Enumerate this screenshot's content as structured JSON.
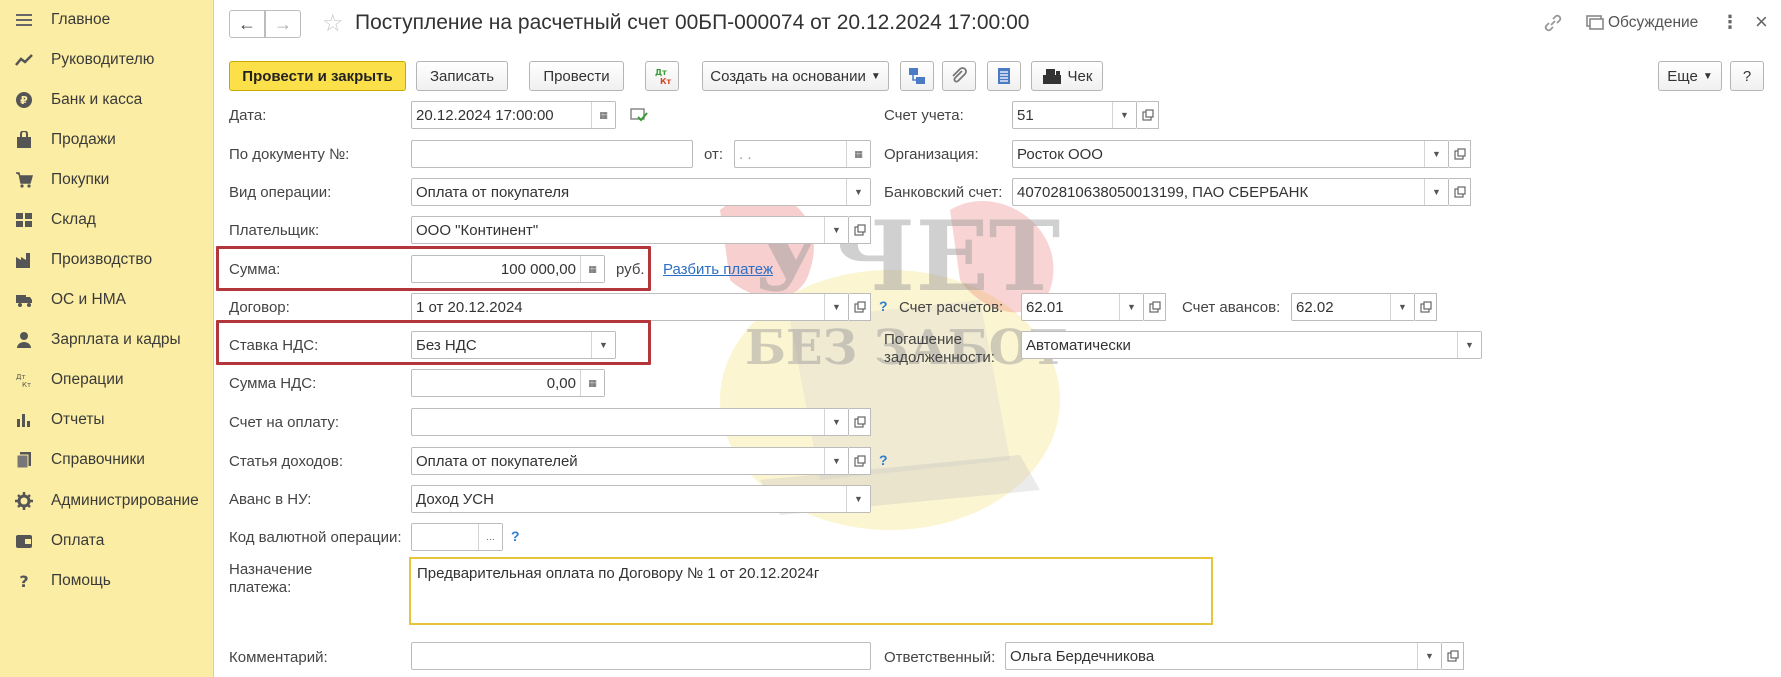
{
  "sidebar": {
    "items": [
      {
        "label": "Главное",
        "icon": "menu-icon"
      },
      {
        "label": "Руководителю",
        "icon": "trend-icon"
      },
      {
        "label": "Банк и касса",
        "icon": "ruble-coin-icon"
      },
      {
        "label": "Продажи",
        "icon": "shopping-bag-icon"
      },
      {
        "label": "Покупки",
        "icon": "cart-icon"
      },
      {
        "label": "Склад",
        "icon": "warehouse-icon"
      },
      {
        "label": "Производство",
        "icon": "factory-icon"
      },
      {
        "label": "ОС и НМА",
        "icon": "truck-icon"
      },
      {
        "label": "Зарплата и кадры",
        "icon": "person-icon"
      },
      {
        "label": "Операции",
        "icon": "dt-kt-icon"
      },
      {
        "label": "Отчеты",
        "icon": "bar-chart-icon"
      },
      {
        "label": "Справочники",
        "icon": "book-icon"
      },
      {
        "label": "Администрирование",
        "icon": "gear-icon"
      },
      {
        "label": "Оплата",
        "icon": "wallet-icon"
      },
      {
        "label": "Помощь",
        "icon": "question-icon"
      }
    ]
  },
  "header": {
    "title": "Поступление на расчетный счет 00БП-000074 от 20.12.2024 17:00:00",
    "discussion": "Обсуждение"
  },
  "toolbar": {
    "post_close": "Провести и закрыть",
    "save": "Записать",
    "post": "Провести",
    "create_based": "Создать на основании",
    "receipt": "Чек",
    "more": "Еще",
    "help": "?",
    "dtkt_top": "Дт",
    "dtkt_bottom": "Кт"
  },
  "form": {
    "date": {
      "label": "Дата:",
      "value": "20.12.2024 17:00:00"
    },
    "doc_number": {
      "label": "По документу №:",
      "value": "",
      "from_label": "от:",
      "from_value": " .  .  "
    },
    "operation": {
      "label": "Вид операции:",
      "value": "Оплата от покупателя"
    },
    "payer": {
      "label": "Плательщик:",
      "value": "ООО \"Континент\""
    },
    "amount": {
      "label": "Сумма:",
      "value": "100 000,00",
      "currency": "руб.",
      "split_link": "Разбить платеж"
    },
    "contract": {
      "label": "Договор:",
      "value": "1 от 20.12.2024"
    },
    "vat_rate": {
      "label": "Ставка НДС:",
      "value": "Без НДС"
    },
    "vat_amount": {
      "label": "Сумма НДС:",
      "value": "0,00"
    },
    "invoice": {
      "label": "Счет на оплату:",
      "value": ""
    },
    "income_item": {
      "label": "Статья доходов:",
      "value": "Оплата от покупателей"
    },
    "advance_nu": {
      "label": "Аванс в НУ:",
      "value": "Доход УСН"
    },
    "currency_op": {
      "label": "Код валютной операции:",
      "value": ""
    },
    "purpose": {
      "label_line1": "Назначение",
      "label_line2": "платежа:",
      "value": "Предварительная оплата по Договору № 1 от 20.12.2024г"
    },
    "comment": {
      "label": "Комментарий:",
      "value": ""
    },
    "account": {
      "label": "Счет учета:",
      "value": "51"
    },
    "organization": {
      "label": "Организация:",
      "value": "Росток ООО"
    },
    "bank_account": {
      "label": "Банковский счет:",
      "value": "40702810638050013199, ПАО СБЕРБАНК"
    },
    "settlement_account": {
      "label": "Счет расчетов:",
      "value": "62.01"
    },
    "advance_account": {
      "label": "Счет авансов:",
      "value": "62.02"
    },
    "debt_repayment": {
      "label_line1": "Погашение",
      "label_line2": "задолженности:",
      "value": "Автоматически"
    },
    "responsible": {
      "label": "Ответственный:",
      "value": "Ольга Бердечникова"
    },
    "help_mark": "?"
  },
  "watermark": {
    "line1": "УЧЕТ",
    "line2": "БЕЗ ЗАБОТ"
  },
  "colors": {
    "sidebar_bg": "#fbeda3",
    "primary_button": "#fce04a",
    "highlight": "#b3373a",
    "link": "#2d6fc4"
  }
}
